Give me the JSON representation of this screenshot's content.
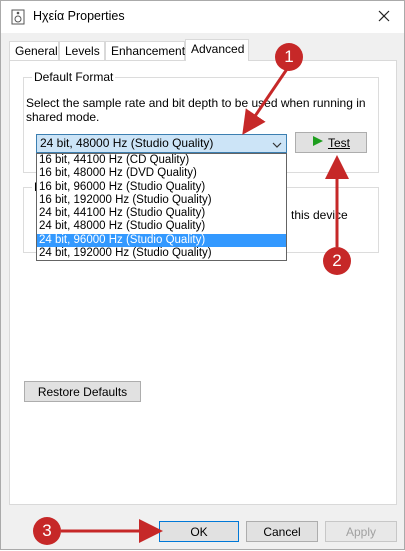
{
  "window": {
    "title": "Ηχεία Properties"
  },
  "tabs": [
    {
      "label": "General"
    },
    {
      "label": "Levels"
    },
    {
      "label": "Enhancements"
    },
    {
      "label": "Advanced"
    }
  ],
  "default_format": {
    "group_label": "Default Format",
    "description": "Select the sample rate and bit depth to be used when running in shared mode.",
    "selected_value": "24 bit, 48000 Hz (Studio Quality)",
    "test_label": "Test",
    "options": [
      "16 bit, 44100 Hz (CD Quality)",
      "16 bit, 48000 Hz (DVD Quality)",
      "16 bit, 96000 Hz (Studio Quality)",
      "16 bit, 192000 Hz (Studio Quality)",
      "24 bit, 44100 Hz (Studio Quality)",
      "24 bit, 48000 Hz (Studio Quality)",
      "24 bit, 96000 Hz (Studio Quality)",
      "24 bit, 192000 Hz (Studio Quality)"
    ],
    "highlighted_option": "24 bit, 96000 Hz (Studio Quality)"
  },
  "exclusive_mode": {
    "partial_text": "this device"
  },
  "restore_defaults_label": "Restore Defaults",
  "footer": {
    "ok_label": "OK",
    "cancel_label": "Cancel",
    "apply_label": "Apply"
  },
  "markers": [
    {
      "number": "1"
    },
    {
      "number": "2"
    },
    {
      "number": "3"
    }
  ],
  "colors": {
    "marker": "#c62828",
    "highlight": "#3399ff",
    "focus": "#0078d7"
  }
}
